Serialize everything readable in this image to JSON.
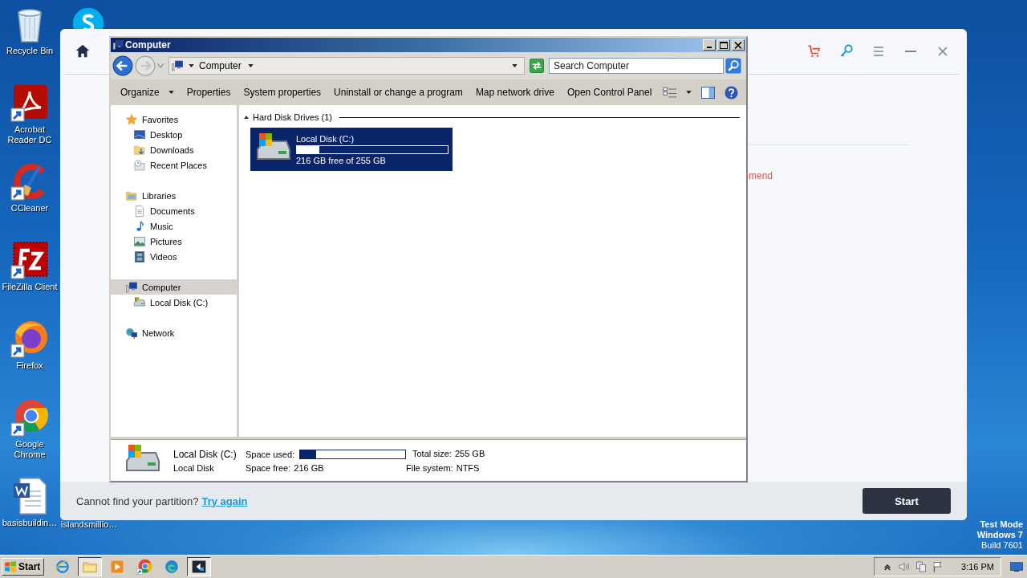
{
  "desktop": {
    "icons": [
      {
        "kind": "recycle",
        "label": "Recycle Bin"
      },
      {
        "kind": "pdf",
        "label": "Acrobat Reader DC"
      },
      {
        "kind": "ccleaner",
        "label": "CCleaner"
      },
      {
        "kind": "filezilla",
        "label": "FileZilla Client"
      },
      {
        "kind": "firefox",
        "label": "Firefox"
      },
      {
        "kind": "chrome",
        "label": "Google Chrome"
      },
      {
        "kind": "word",
        "label": "basisbuildin…"
      }
    ],
    "second_column": [
      {
        "kind": "skype"
      },
      {
        "kind": "hidden",
        "label": "islandsmillio…"
      }
    ],
    "os_note": [
      {
        "text": "Test Mode",
        "bold": true
      },
      {
        "text": "Windows 7",
        "bold": true
      },
      {
        "text": "Build 7601",
        "bold": false
      }
    ]
  },
  "app": {
    "sidebar": [
      {
        "kind": "home"
      }
    ],
    "header_buttons": [
      {
        "kind": "cart"
      },
      {
        "kind": "key"
      },
      {
        "kind": "menu"
      },
      {
        "kind": "minimize"
      },
      {
        "kind": "close"
      }
    ],
    "notice": "mend",
    "footer": {
      "prompt": "Cannot find your partition?",
      "link": "Try again",
      "button": "Start"
    }
  },
  "explorer": {
    "title": "Computer",
    "address": {
      "crumbs": [
        "Computer"
      ]
    },
    "search": {
      "placeholder": "Search Computer"
    },
    "commands": [
      {
        "label": "Organize",
        "dropdown": true
      },
      {
        "label": "Properties",
        "dropdown": false
      },
      {
        "label": "System properties",
        "dropdown": false
      },
      {
        "label": "Uninstall or change a program",
        "dropdown": false
      },
      {
        "label": "Map network drive",
        "dropdown": false
      },
      {
        "label": "Open Control Panel",
        "dropdown": false
      }
    ],
    "nav": [
      {
        "kind": "star",
        "label": "Favorites",
        "selected": false,
        "children": [
          {
            "kind": "desktop",
            "label": "Desktop",
            "selected": false
          },
          {
            "kind": "downloads",
            "label": "Downloads",
            "selected": false
          },
          {
            "kind": "recent",
            "label": "Recent Places",
            "selected": false
          }
        ]
      },
      {
        "kind": "library",
        "label": "Libraries",
        "selected": false,
        "children": [
          {
            "kind": "document",
            "label": "Documents",
            "selected": false
          },
          {
            "kind": "music",
            "label": "Music",
            "selected": false
          },
          {
            "kind": "pictures",
            "label": "Pictures",
            "selected": false
          },
          {
            "kind": "videos",
            "label": "Videos",
            "selected": false
          }
        ]
      },
      {
        "kind": "computer",
        "label": "Computer",
        "selected": true,
        "children": [
          {
            "kind": "drive",
            "label": "Local Disk (C:)",
            "selected": false
          }
        ]
      },
      {
        "kind": "network",
        "label": "Network",
        "selected": false
      }
    ],
    "group": {
      "title": "Hard Disk Drives (1)",
      "expanded": true
    },
    "drives": [
      {
        "name": "Local Disk (C:)",
        "level": 0.15,
        "free": "216 GB free of 255 GB",
        "selected": true
      }
    ],
    "details": {
      "name": "Local Disk (C:)",
      "type": "Local Disk",
      "used_label": "Space used:",
      "level": 0.15,
      "free_label": "Space free:",
      "free_value": "216 GB",
      "total_label": "Total size:",
      "total_value": "255 GB",
      "fs_label": "File system:",
      "fs_value": "NTFS"
    }
  },
  "taskbar": {
    "start": "Start",
    "apps": [
      {
        "kind": "ie",
        "selected": false
      },
      {
        "kind": "explorer",
        "selected": true
      },
      {
        "kind": "media",
        "selected": false
      },
      {
        "kind": "chrome",
        "selected": false
      },
      {
        "kind": "edge",
        "selected": false
      },
      {
        "kind": "app",
        "selected": true
      }
    ],
    "tray": [
      {
        "kind": "arrow"
      },
      {
        "kind": "speaker"
      },
      {
        "kind": "network"
      },
      {
        "kind": "flag"
      }
    ],
    "clock": "3:16 PM"
  }
}
